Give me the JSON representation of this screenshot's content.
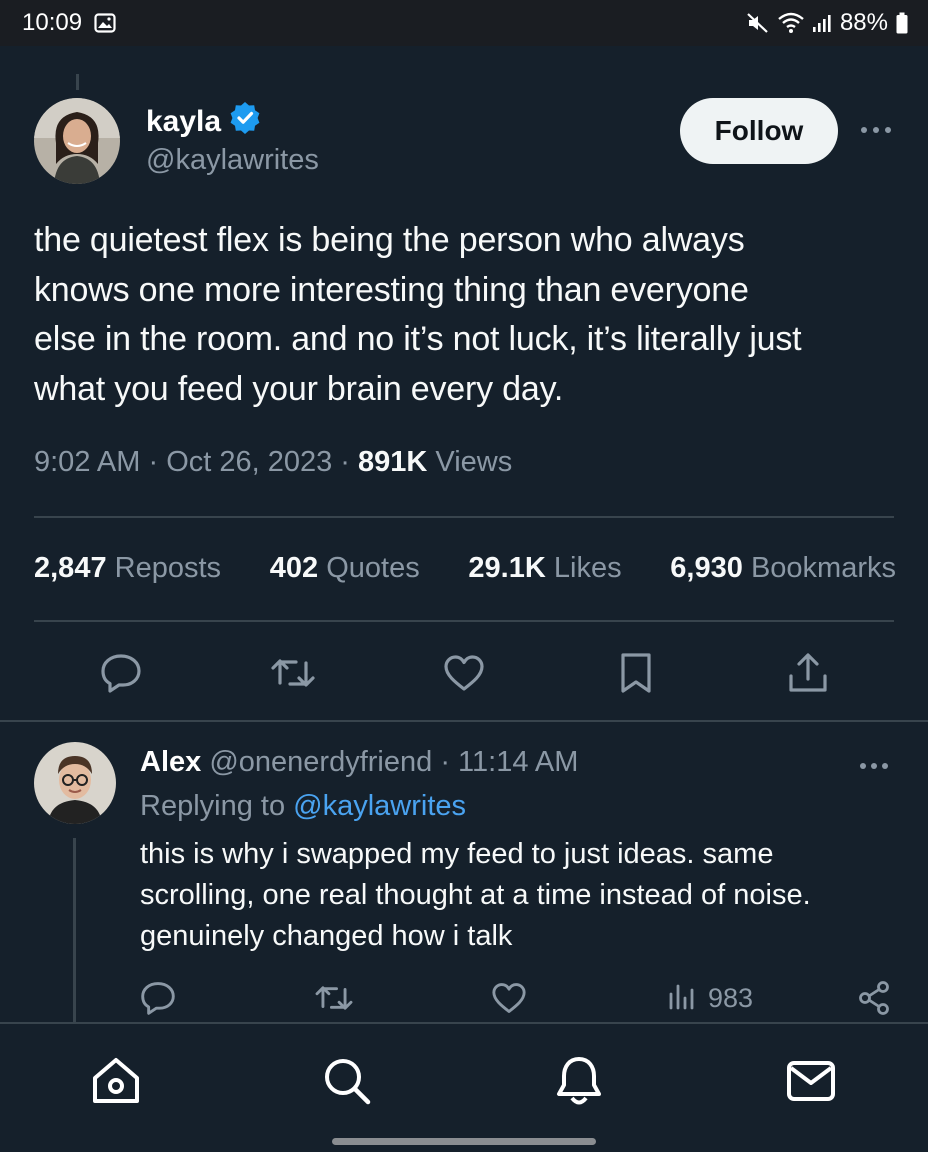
{
  "status_bar": {
    "time": "10:09",
    "battery": "88%",
    "icons": [
      "gallery-icon",
      "mute-icon",
      "wifi-icon",
      "signal-icon",
      "battery-icon"
    ]
  },
  "tweet": {
    "author_name": "kayla",
    "author_handle": "@kaylawrites",
    "verified": true,
    "follow_label": "Follow",
    "text": "the quietest flex is being the person who always\nknows one more interesting thing than everyone\nelse in the room. and no it’s not luck, it’s literally just\nwhat you feed your brain every day.",
    "time": "9:02 AM",
    "date": "Oct 26, 2023",
    "views_count": "891K",
    "views_label": "Views",
    "stats": {
      "reposts_count": "2,847",
      "reposts_label": "Reposts",
      "quotes_count": "402",
      "quotes_label": "Quotes",
      "likes_count": "29.1K",
      "likes_label": "Likes",
      "bookmarks_count": "6,930",
      "bookmarks_label": "Bookmarks"
    },
    "actions": [
      "reply-icon",
      "repost-icon",
      "like-icon",
      "bookmark-icon",
      "share-icon"
    ]
  },
  "reply": {
    "author_name": "Alex",
    "author_handle": "@onenerdyfriend",
    "time": "11:14 AM",
    "replying_prefix": "Replying to",
    "replying_to": "@kaylawrites",
    "text": "this is why i swapped my feed to just ideas. same\nscrolling, one real thought at a time instead of noise.\ngenuinely changed how i talk",
    "views": "983"
  },
  "bottom_nav": [
    "home-icon",
    "search-icon",
    "notifications-icon",
    "messages-icon"
  ],
  "colors": {
    "background": "#15202b",
    "accent": "#1d9bf0",
    "secondary_text": "#8b98a5",
    "mention": "#4aa3f0"
  }
}
